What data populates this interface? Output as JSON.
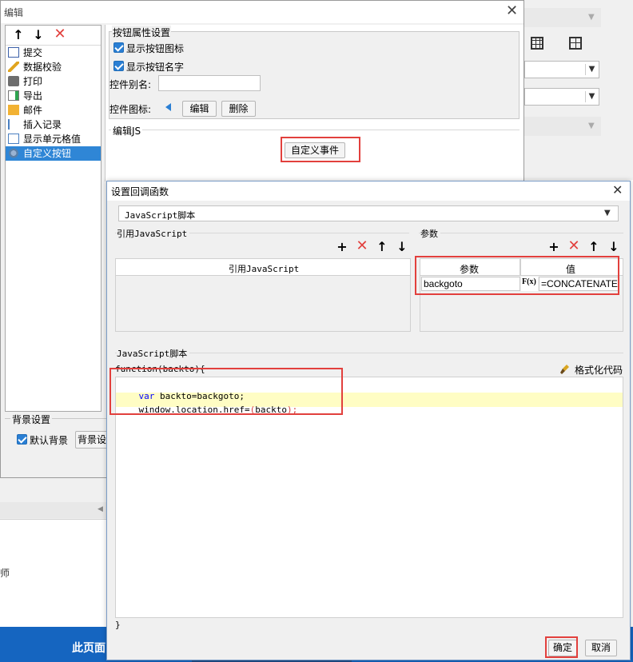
{
  "background": {
    "footer_text": "此页面",
    "left_frag": "师"
  },
  "edit_window": {
    "title": "编辑",
    "list_items": [
      {
        "label": "提交",
        "icon": "submit-icon"
      },
      {
        "label": "数据校验",
        "icon": "pencil-icon"
      },
      {
        "label": "打印",
        "icon": "printer-icon"
      },
      {
        "label": "导出",
        "icon": "export-icon"
      },
      {
        "label": "邮件",
        "icon": "mail-icon"
      },
      {
        "label": "插入记录",
        "icon": "insert-record-icon"
      },
      {
        "label": "显示单元格值",
        "icon": "cell-value-icon"
      },
      {
        "label": "自定义按钮",
        "icon": "gear-icon"
      }
    ],
    "bg_section": "背景设置",
    "default_bg": "默认背景",
    "bg_button": "背景设",
    "props_title": "按钮属性设置",
    "show_icon": "显示按钮图标",
    "show_name": "显示按钮名字",
    "alias_label": "控件别名:",
    "alias_value": "",
    "icon_label": "控件图标:",
    "edit_btn": "编辑",
    "delete_btn": "删除",
    "editjs_label": "编辑JS",
    "custom_event_btn": "自定义事件"
  },
  "callback_dialog": {
    "title": "设置回调函数",
    "type_select": "JavaScript脚本",
    "ref_js_label": "引用JavaScript",
    "ref_js_header": "引用JavaScript",
    "params_label": "参数",
    "param_col": "参数",
    "value_col": "值",
    "param_name": "backgoto",
    "fx_label": "F(x)",
    "param_value": "=CONCATENATE",
    "script_label": "JavaScript脚本",
    "format_btn": "格式化代码",
    "func_header": "function(backto){",
    "code_line1_kw": "var",
    "code_line1_rest": " backto=backgoto;",
    "code_line2_a": "window.location.href=",
    "code_line2_b": "(",
    "code_line2_c": "backto",
    "code_line2_d": ");",
    "func_footer": "}",
    "ok": "确定",
    "cancel": "取消"
  },
  "colors": {
    "accent_blue": "#2a7fd4",
    "highlight_red": "#e2403d",
    "code_highlight": "#fffdc4",
    "footer_blue": "#1565c0"
  }
}
